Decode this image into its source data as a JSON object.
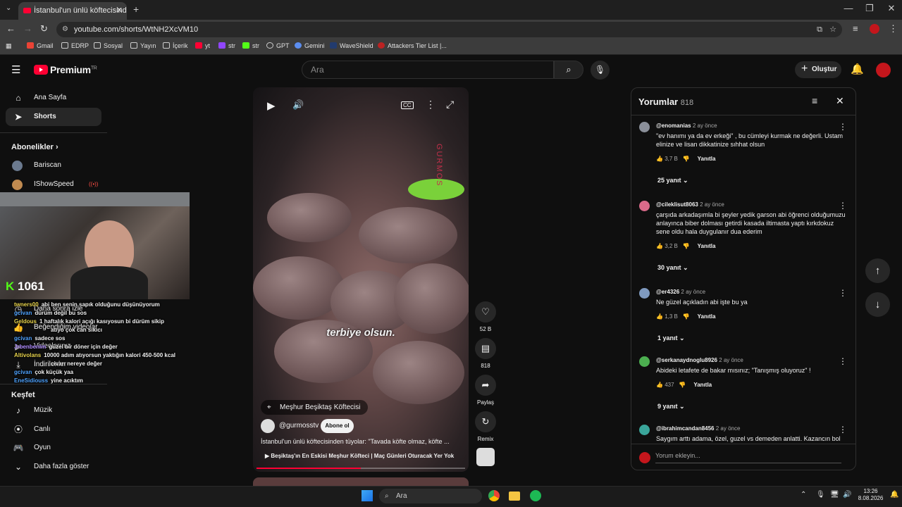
{
  "browser": {
    "tab_title": "İstanbul'un ünlü köftecisinden tüyolar",
    "url": "youtube.com/shorts/WtNH2XcVM10",
    "bookmarks": [
      "Gmail",
      "EDRP",
      "Sosyal",
      "Yayın",
      "İçerik",
      "yt",
      "str",
      "str",
      "GPT",
      "Gemini",
      "WaveShield",
      "Attackers Tier List |..."
    ]
  },
  "header": {
    "logo": "Premium",
    "logo_region": "TR",
    "search_placeholder": "Ara",
    "create_label": "Oluştur"
  },
  "sidebar": {
    "home": "Ana Sayfa",
    "shorts": "Shorts",
    "subs_heading": "Abonelikler",
    "subs": [
      "Bariscan",
      "IShowSpeed"
    ],
    "watch_later": "Daha sonra izle",
    "liked": "Beğendiğim videolar",
    "my_videos": "Videolarınız",
    "downloads": "İndirilenler",
    "explore_heading": "Keşfet",
    "explore": [
      "Müzik",
      "Canlı",
      "Oyun"
    ],
    "show_more": "Daha fazla göster"
  },
  "overlay": {
    "kick_count": "1061",
    "chat": [
      {
        "name": "twners00",
        "msg": "abi ben senin sapık olduğunu düşünüyorum",
        "color": "#e8d44d"
      },
      {
        "name": "gcivan",
        "msg": "dürüm değil bu sos",
        "color": "#4fa3ff"
      },
      {
        "name": "Geldous",
        "msg": "1 haftalık kalori açığı kasıyosun bi dürüm sikip",
        "color": "#e8d44d"
      },
      {
        "name": "",
        "msg": "atıyo çok can sıkıcı",
        "color": "#ffffff"
      },
      {
        "name": "gcivan",
        "msg": "sadece sos",
        "color": "#4fa3ff"
      },
      {
        "name": "Jrbenbenim",
        "msg": "güzel bir döner için değer",
        "color": "#b08cff"
      },
      {
        "name": "Altivolans",
        "msg": "10000 adım atıyorsun yaktığın kalori 450-500 kcal",
        "color": "#e8d44d"
      },
      {
        "name": "",
        "msg": "civarı nereye değer",
        "color": "#ffffff"
      },
      {
        "name": "gcivan",
        "msg": "çok küçük yaa",
        "color": "#4fa3ff"
      },
      {
        "name": "EneSidiouss",
        "msg": "yine acıktım",
        "color": "#4fa3ff"
      }
    ]
  },
  "video": {
    "caption": "terbiye olsun.",
    "location": "Meşhur Beşiktaş Köftecisi",
    "channel": "@gurmosstv",
    "subscribe": "Abone ol",
    "title": "İstanbul'un ünlü köftecisinden tüyolar: \"Tavada köfte olmaz, köfte ...",
    "link": "Beşiktaş'ın En Eskisi Meşhur Köfteci | Maç Günleri Oturacak Yer Yok",
    "watermark": "GURMOS",
    "likes": "52 B",
    "comments_count": "818",
    "share": "Paylaş",
    "remix": "Remix",
    "progress": 0.5
  },
  "comments": {
    "title": "Yorumlar",
    "count": "818",
    "reply_label": "Yanıtla",
    "add_placeholder": "Yorum ekleyin...",
    "items": [
      {
        "user": "@enomanias",
        "time": "2 ay önce",
        "text": "\"ev hanımı ya da ev erkeği\" , bu cümleyi kurmak ne değerli. Ustam elinize ve lisan dikkatinize sıhhat olsun",
        "likes": "3,7 B",
        "replies": "25 yanıt",
        "avatar": "#8a8f99"
      },
      {
        "user": "@cileklisut8063",
        "time": "2 ay önce",
        "text": "çarşıda arkadaşımla bi şeyler yedik garson abi öğrenci olduğumuzu anlayınca biber dolması getirdi kasada iltimasta yaptı kırkdokuz sene oldu hala duygulanır dua ederim",
        "likes": "3,2 B",
        "replies": "30 yanıt",
        "avatar": "#d96a8a"
      },
      {
        "user": "@er4326",
        "time": "2 ay önce",
        "text": "Ne güzel açıkladın abi  işte bu  ya",
        "likes": "1,3 B",
        "replies": "1 yanıt",
        "avatar": "#7f9abf"
      },
      {
        "user": "@serkanaydnoglu8926",
        "time": "2 ay önce",
        "text": "Abideki letafete de bakar mısınız; \"Tanışmış oluyoruz\" !",
        "likes": "437",
        "replies": "9 yanıt",
        "avatar": "#4caf50"
      },
      {
        "user": "@ibrahimcandan8456",
        "time": "2 ay önce",
        "text": "Saygım arttı adama, özel, guzel vs demeden anlatti. Kazancın bol",
        "likes": "",
        "replies": "",
        "avatar": "#3aa59a"
      }
    ]
  },
  "taskbar": {
    "search": "Ara",
    "time": "13:26",
    "date": "8.08.2026"
  }
}
